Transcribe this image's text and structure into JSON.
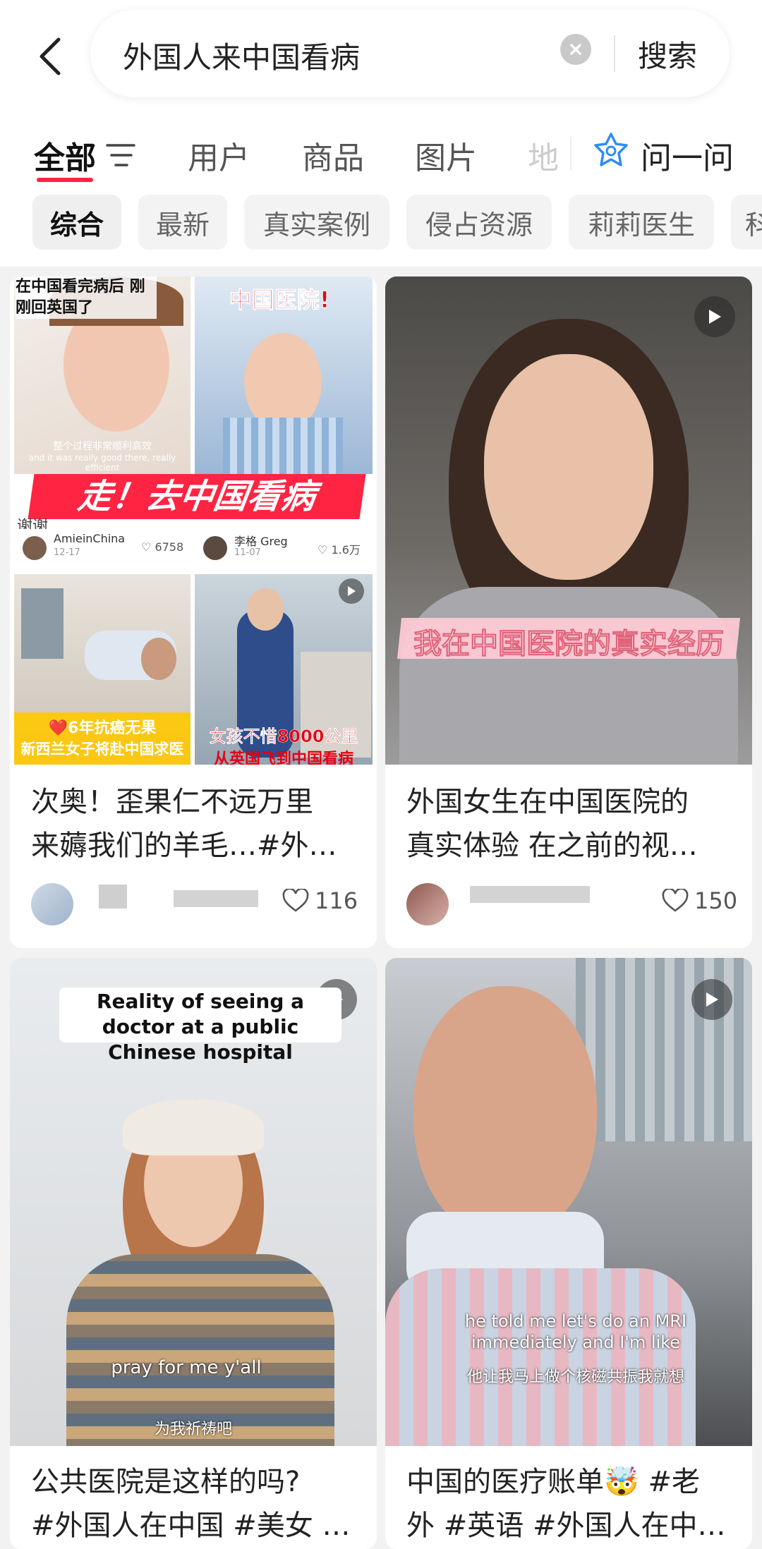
{
  "search": {
    "query": "外国人来中国看病",
    "button": "搜索"
  },
  "tabs": [
    "全部",
    "用户",
    "商品",
    "图片",
    "地"
  ],
  "ask": "问一问",
  "chips": [
    "综合",
    "最新",
    "真实案例",
    "侵占资源",
    "莉莉医生",
    "科"
  ],
  "accent": "#ff2442",
  "cards": [
    {
      "title_line1": "次奥！歪果仁不远万里",
      "title_line2": "来薅我们的羊毛…#外…",
      "likes": "116",
      "collage": {
        "a_caption_top": "在中国看完病后 刚刚回英国了",
        "a_subtitle_cn": "整个过程非常顺利高效",
        "a_subtitle_en": "and it was really good there, really efficient",
        "a_author": "AmieinChina",
        "a_date": "12-17",
        "a_likes": "6758",
        "b_caption_top": "中国医院!",
        "b_author": "李格 Greg",
        "b_date": "11-07",
        "b_likes": "1.6万",
        "banner": "走！去中国看病",
        "thank_text": "谢谢",
        "c_caption1": "❤️6年抗癌无果",
        "c_caption2": "新西兰女子将赴中国求医",
        "d_caption1": "女孩不惜8000公里",
        "d_caption2": "从英国飞到中国看病"
      }
    },
    {
      "title_line1": "外国女生在中国医院的",
      "title_line2": "真实体验 在之前的视…",
      "likes": "150",
      "cover_caption": "我在中国医院的真实经历"
    },
    {
      "title_line1": "公共医院是这样的吗?",
      "title_line2": "#外国人在中国 #美女 …",
      "cover_caption_top": "Reality of seeing a doctor at a public Chinese hospital",
      "cover_caption_en": "pray for me y'all",
      "cover_caption_cn": "为我祈祷吧"
    },
    {
      "title_line1": "中国的医疗账单🤯 #老",
      "title_line2": "外 #英语 #外国人在中…",
      "cover_caption_en": "he told me let's do an MRI immediately and I'm like",
      "cover_caption_cn": "他让我马上做个核磁共振我就想"
    }
  ]
}
